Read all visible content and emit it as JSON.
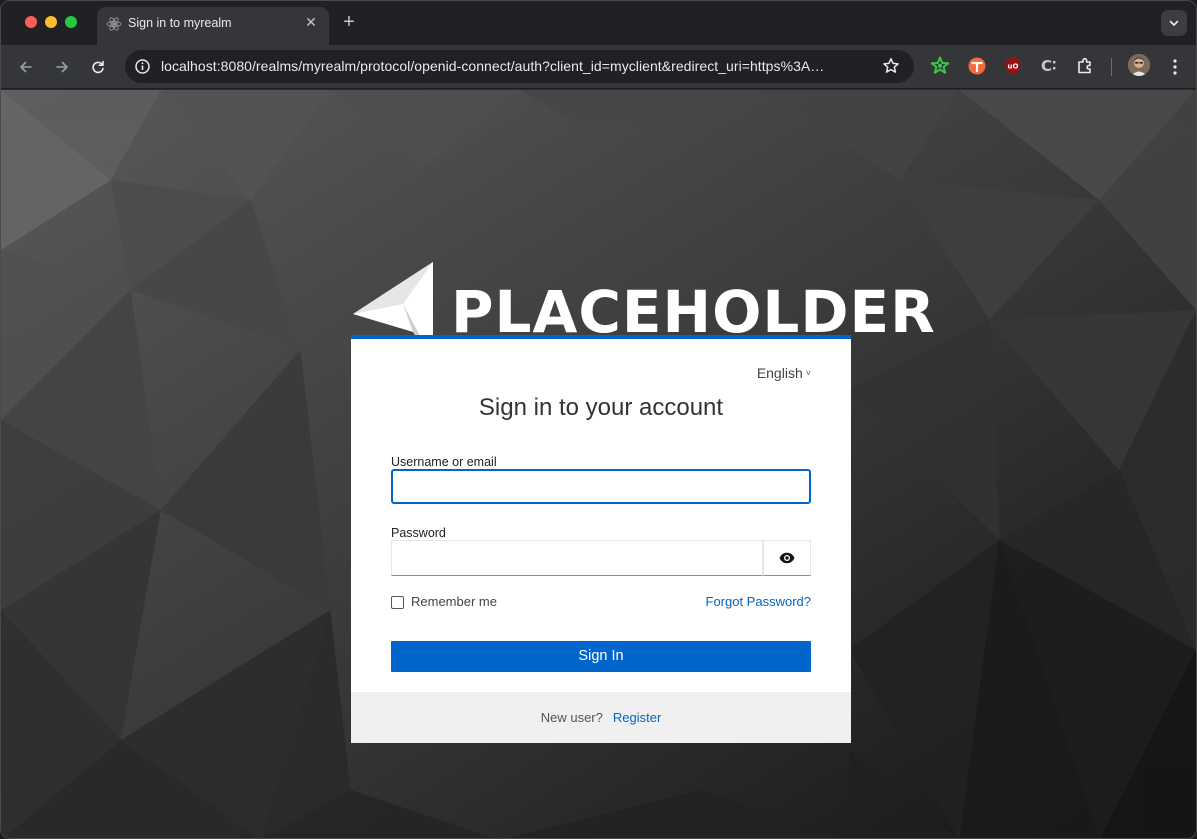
{
  "browser": {
    "tab_title": "Sign in to myrealm",
    "tab_close": "✕",
    "new_tab": "+",
    "url": "localhost:8080/realms/myrealm/protocol/openid-connect/auth?client_id=myclient&redirect_uri=https%3A…",
    "tab_search_icon": "chevron-down-icon",
    "back_icon": "back-arrow-icon",
    "forward_icon": "forward-arrow-icon",
    "reload_icon": "reload-icon",
    "star_icon": "star-icon",
    "menu_icon": "vertical-dots-icon",
    "extension_icons": [
      "green-star-icon",
      "orange-circle-icon",
      "ublock-icon",
      "c-bracket-icon",
      "puzzle-icon"
    ]
  },
  "page": {
    "logo_text": "PLACEHOLDER",
    "language": "English",
    "language_caret": "˅",
    "title": "Sign in to your account",
    "username_label": "Username or email",
    "username_value": "",
    "password_label": "Password",
    "password_value": "",
    "remember_me": "Remember me",
    "forgot_password": "Forgot Password?",
    "sign_in": "Sign In",
    "new_user": "New user?",
    "register": "Register"
  },
  "colors": {
    "accent": "#0066cc",
    "card_bg": "#ffffff",
    "footer_bg": "#f0f0f0"
  }
}
